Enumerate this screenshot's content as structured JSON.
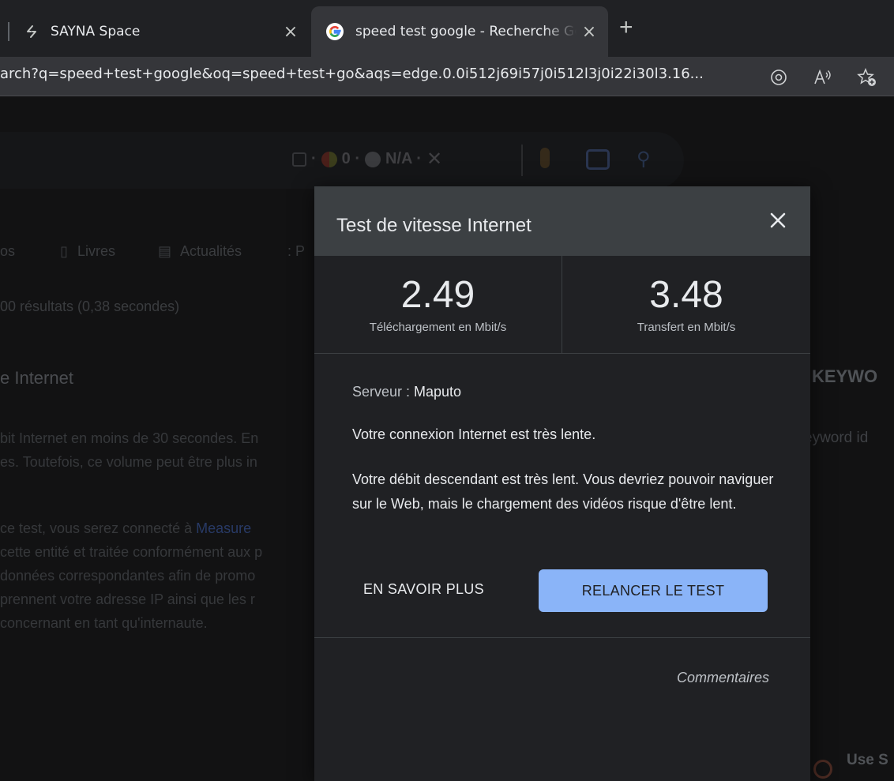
{
  "tabs": [
    {
      "title": "SAYNA Space",
      "close": "×"
    },
    {
      "title": "speed test google - Recherche Google",
      "close": "×"
    }
  ],
  "new_tab": "+",
  "address": {
    "url": "arch?q=speed+test+google&oq=speed+test+go&aqs=edge.0.0i512j69i57j0i512l3j0i22i30l3.16..."
  },
  "background": {
    "search_extensions": [
      "·",
      "0 ·",
      "N/A ·"
    ],
    "nav_tabs": [
      "os",
      "Livres",
      "Actualités",
      ": P"
    ],
    "results_count": "00 résultats (0,38 secondes)",
    "page_title": "e Internet",
    "paragraph1": [
      "bit Internet en moins de 30 secondes. En",
      "es. Toutefois, ce volume peut être plus in"
    ],
    "paragraph2": [
      "ce test, vous serez connecté à ",
      "cette entité et traitée conformément aux p",
      "données correspondantes afin de promo",
      "prennent votre adresse IP ainsi que les r",
      "concernant en tant qu'internaute."
    ],
    "paragraph2_link": "Measure",
    "sidebar_heading": "KEYWO",
    "sidebar_text": "eyword id",
    "sidebar_bottom": "Use S"
  },
  "dialog": {
    "title": "Test de vitesse Internet",
    "download": {
      "value": "2.49",
      "label": "Téléchargement en Mbit/s"
    },
    "upload": {
      "value": "3.48",
      "label": "Transfert en Mbit/s"
    },
    "server_label": "Serveur : ",
    "server_name": "Maputo",
    "status": "Votre connexion Internet est très lente.",
    "detail": "Votre débit descendant est très lent. Vous devriez pouvoir naviguer sur le Web, mais le chargement des vidéos risque d'être lent.",
    "learn_more": "EN SAVOIR PLUS",
    "retest": "RELANCER LE TEST",
    "feedback": "Commentaires"
  },
  "colors": {
    "accent": "#8ab4f8",
    "dialog_bg": "#202124",
    "dialog_header": "#3c4043"
  }
}
